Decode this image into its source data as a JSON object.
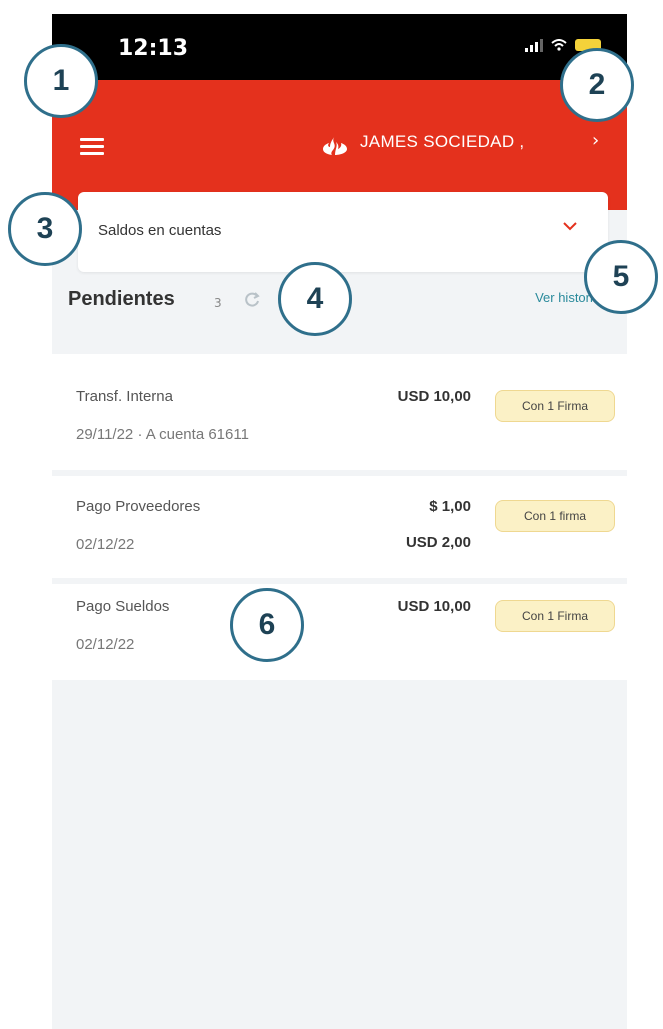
{
  "status_bar": {
    "time": "12:13"
  },
  "header": {
    "company": "JAMES SOCIEDAD ,",
    "company_chevron": "›"
  },
  "dropdown": {
    "label": "Saldos en cuentas"
  },
  "pendientes": {
    "title": "Pendientes",
    "count": "3",
    "history_link": "Ver historial"
  },
  "rows": [
    {
      "title": "Transf. Interna",
      "subtitle": "29/11/22 · A cuenta 61611",
      "amounts": [
        "USD 10,00"
      ],
      "badge": "Con 1 Firma"
    },
    {
      "title": "Pago Proveedores",
      "subtitle": "02/12/22",
      "amounts": [
        "$ 1,00",
        "USD 2,00"
      ],
      "badge": "Con 1 firma"
    },
    {
      "title": "Pago Sueldos",
      "subtitle": "02/12/22",
      "amounts": [
        "USD 10,00"
      ],
      "badge": "Con 1 Firma"
    }
  ],
  "callouts": [
    "1",
    "2",
    "3",
    "4",
    "5",
    "6"
  ],
  "colors": {
    "header": "#e4311d",
    "accent": "#2a8a9b",
    "badge": "#fbf1c6",
    "callout_border": "#2f6f8b"
  }
}
